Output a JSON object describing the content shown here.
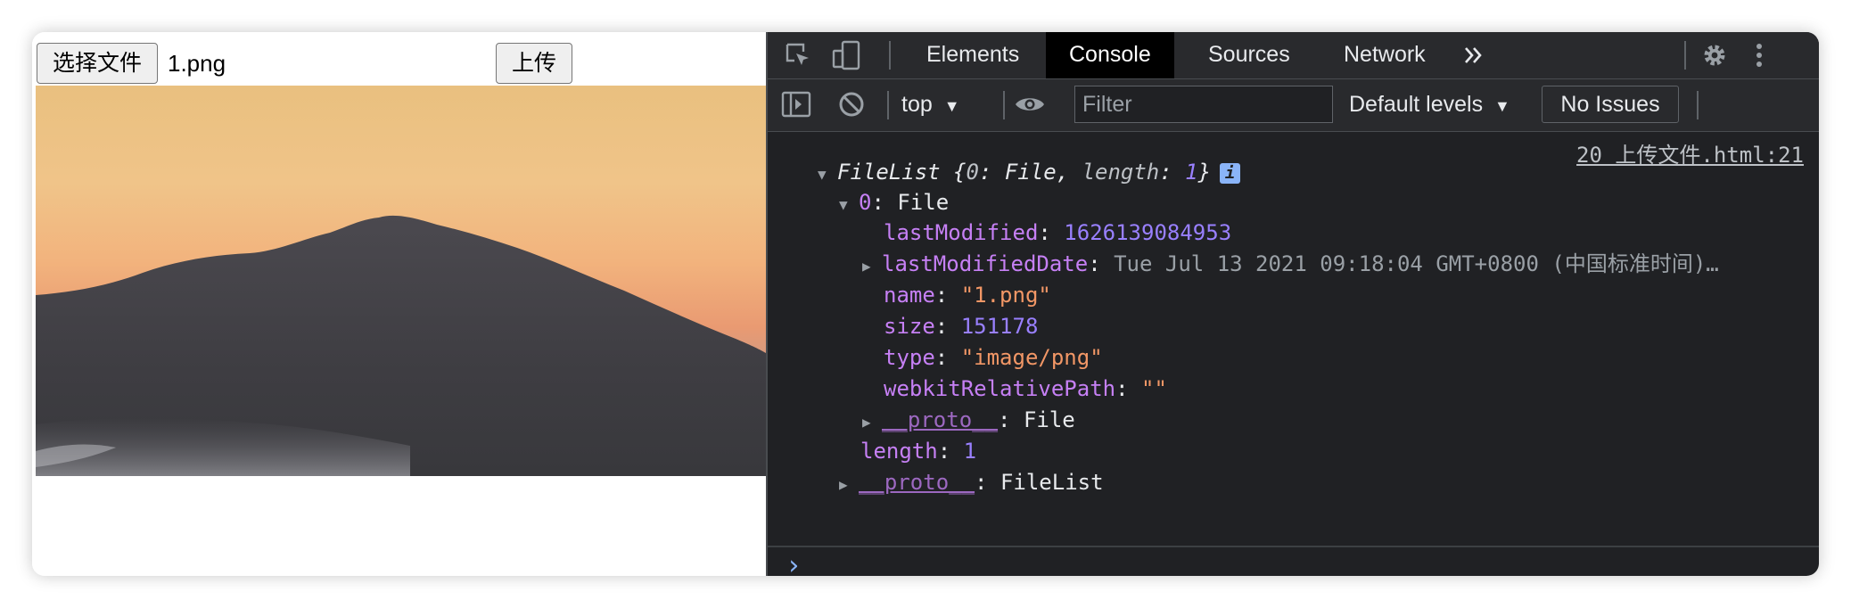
{
  "page": {
    "choose_file_label": "选择文件",
    "file_name": "1.png",
    "upload_label": "上传"
  },
  "devtools": {
    "tabs": [
      "Elements",
      "Console",
      "Sources",
      "Network"
    ],
    "active_tab": "Console",
    "more_tabs_icon": "double-chevron-icon",
    "toolbar": {
      "context": "top",
      "filter_placeholder": "Filter",
      "levels": "Default levels",
      "issues": "No Issues"
    },
    "console": {
      "source_link": "20 上传文件.html:21",
      "header": {
        "type": "FileList",
        "preview_open": "{",
        "k0": "0",
        "v0": "File",
        "k1": "length",
        "v1": "1",
        "preview_close": "}"
      },
      "item0": {
        "key": "0",
        "type": "File"
      },
      "props": [
        {
          "key": "lastModified",
          "value": "1626139084953",
          "kind": "number"
        },
        {
          "key": "lastModifiedDate",
          "value": "Tue Jul 13 2021 09:18:04 GMT+0800 (中国标准时间)…",
          "kind": "dim",
          "expandable": true
        },
        {
          "key": "name",
          "value": "\"1.png\"",
          "kind": "string"
        },
        {
          "key": "size",
          "value": "151178",
          "kind": "number"
        },
        {
          "key": "type",
          "value": "\"image/png\"",
          "kind": "string"
        },
        {
          "key": "webkitRelativePath",
          "value": "\"\"",
          "kind": "string"
        }
      ],
      "file_proto": {
        "key": "__proto__",
        "value": "File"
      },
      "length": {
        "key": "length",
        "value": "1"
      },
      "list_proto": {
        "key": "__proto__",
        "value": "FileList"
      },
      "prompt": "›"
    }
  },
  "colors": {
    "devtools_bg": "#202124",
    "toolbar_bg": "#292a2d",
    "active_tab_bg": "#000000",
    "key_purple": "#c680f5",
    "number_blue": "#9980ff",
    "string_orange": "#f29766"
  }
}
